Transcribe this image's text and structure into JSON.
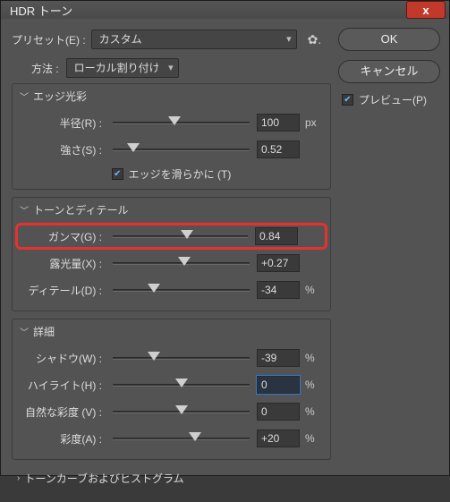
{
  "title": "HDR トーン",
  "close_x": "x",
  "preset": {
    "label": "プリセット(E) :",
    "value": "カスタム"
  },
  "gear_icon": "✿",
  "method": {
    "label": "方法 :",
    "value": "ローカル割り付け"
  },
  "panels": {
    "edge": {
      "title": "エッジ光彩",
      "radius": {
        "label": "半径(R) :",
        "value": "100",
        "unit": "px",
        "pos": 45
      },
      "strength": {
        "label": "強さ(S) :",
        "value": "0.52",
        "pos": 15
      },
      "smooth": {
        "label": "エッジを滑らかに (T)",
        "checked": true
      }
    },
    "tone": {
      "title": "トーンとディテール",
      "gamma": {
        "label": "ガンマ(G) :",
        "value": "0.84",
        "pos": 55
      },
      "exposure": {
        "label": "露光量(X) :",
        "value": "+0.27",
        "pos": 52
      },
      "detail": {
        "label": "ディテール(D) :",
        "value": "-34",
        "unit": "%",
        "pos": 30
      }
    },
    "advanced": {
      "title": "詳細",
      "shadow": {
        "label": "シャドウ(W) :",
        "value": "-39",
        "unit": "%",
        "pos": 30
      },
      "highlight": {
        "label": "ハイライト(H) :",
        "value": "0",
        "unit": "%",
        "pos": 50
      },
      "vibrance": {
        "label": "自然な彩度 (V) :",
        "value": "0",
        "unit": "%",
        "pos": 50
      },
      "saturation": {
        "label": "彩度(A) :",
        "value": "+20",
        "unit": "%",
        "pos": 60
      }
    },
    "curve": {
      "title": "トーンカーブおよびヒストグラム"
    }
  },
  "buttons": {
    "ok": "OK",
    "cancel": "キャンセル"
  },
  "preview": {
    "label": "プレビュー(P)",
    "checked": true
  }
}
